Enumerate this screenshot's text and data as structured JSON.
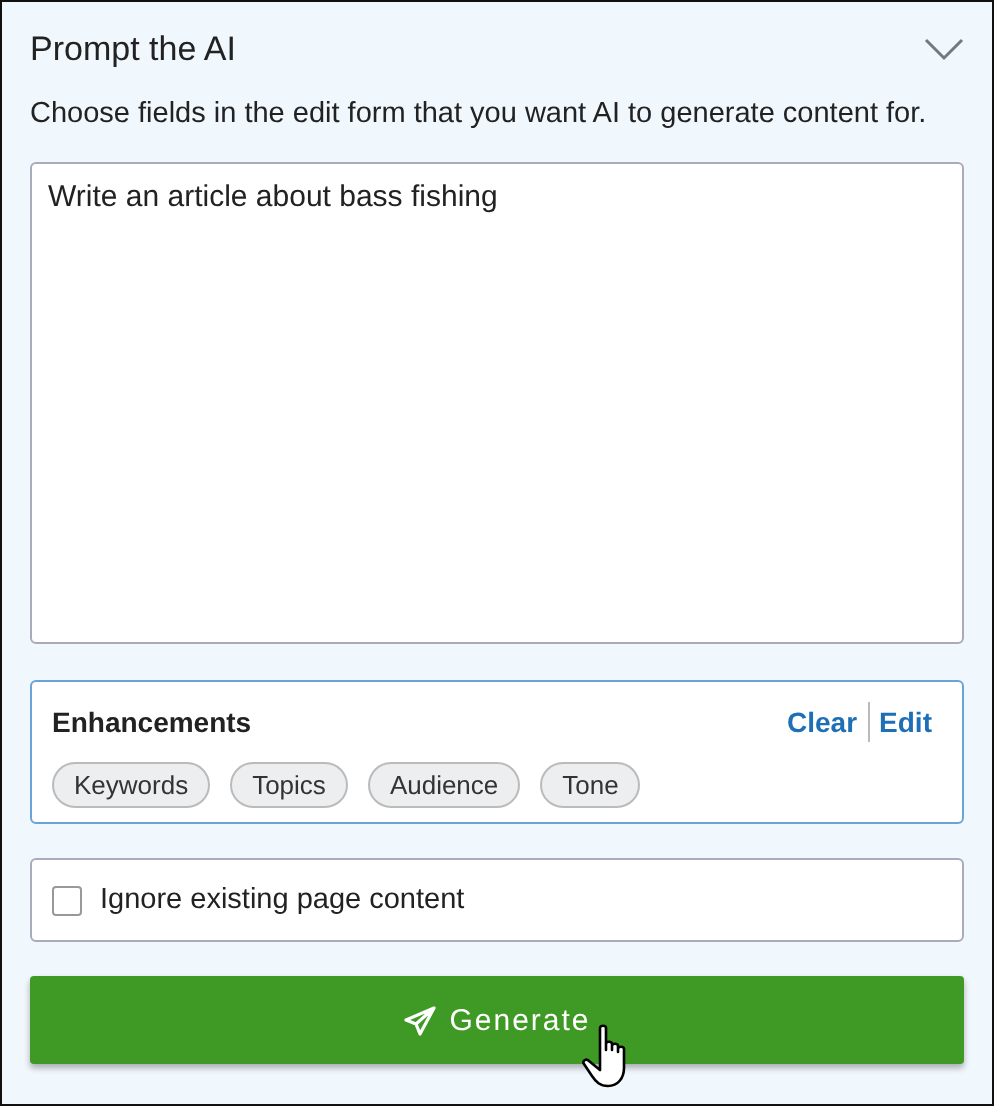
{
  "panel": {
    "title": "Prompt the AI",
    "expanded": true,
    "description": "Choose fields in the edit form that you want AI to generate content for."
  },
  "prompt": {
    "value": "Write an article about bass fishing"
  },
  "enhancements": {
    "title": "Enhancements",
    "actions": [
      "Clear",
      "Edit"
    ],
    "tags": [
      "Keywords",
      "Topics",
      "Audience",
      "Tone"
    ]
  },
  "option": {
    "label": "Ignore existing page content",
    "checked": false
  },
  "generate_button": {
    "label": "Generate"
  }
}
